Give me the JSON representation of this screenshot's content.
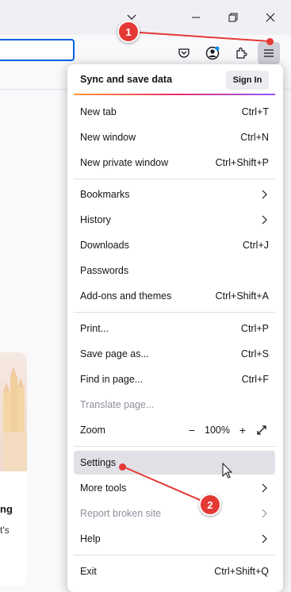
{
  "window_controls": {
    "collapse_icon": "chevron-down-icon",
    "restore_icon": "restore-icon",
    "close_icon": "close-icon"
  },
  "toolbar": {
    "icons": [
      "pocket-icon",
      "account-icon",
      "extensions-icon",
      "hamburger-menu-icon"
    ]
  },
  "background_card": {
    "title_fragment": "ng",
    "subtitle_fragment": "t's"
  },
  "menu": {
    "sync": {
      "title": "Sync and save data",
      "signin_label": "Sign In"
    },
    "items": [
      {
        "label": "New tab",
        "shortcut": "Ctrl+T"
      },
      {
        "label": "New window",
        "shortcut": "Ctrl+N"
      },
      {
        "label": "New private window",
        "shortcut": "Ctrl+Shift+P"
      },
      {
        "label": "Bookmarks",
        "shortcut": ""
      },
      {
        "label": "History",
        "shortcut": ""
      },
      {
        "label": "Downloads",
        "shortcut": "Ctrl+J"
      },
      {
        "label": "Passwords",
        "shortcut": ""
      },
      {
        "label": "Add-ons and themes",
        "shortcut": "Ctrl+Shift+A"
      },
      {
        "label": "Print...",
        "shortcut": "Ctrl+P"
      },
      {
        "label": "Save page as...",
        "shortcut": "Ctrl+S"
      },
      {
        "label": "Find in page...",
        "shortcut": "Ctrl+F"
      },
      {
        "label": "Translate page...",
        "shortcut": ""
      },
      {
        "label": "Zoom",
        "zoom_minus": "−",
        "zoom_value": "100%",
        "zoom_plus": "+"
      },
      {
        "label": "Settings",
        "shortcut": ""
      },
      {
        "label": "More tools",
        "shortcut": ""
      },
      {
        "label": "Report broken site",
        "shortcut": ""
      },
      {
        "label": "Help",
        "shortcut": ""
      },
      {
        "label": "Exit",
        "shortcut": "Ctrl+Shift+Q"
      }
    ]
  },
  "annotations": [
    {
      "label": "1"
    },
    {
      "label": "2"
    }
  ],
  "colors": {
    "accent": "#0061e0",
    "annotation": "#e53935",
    "hover": "#e0e0e6"
  }
}
